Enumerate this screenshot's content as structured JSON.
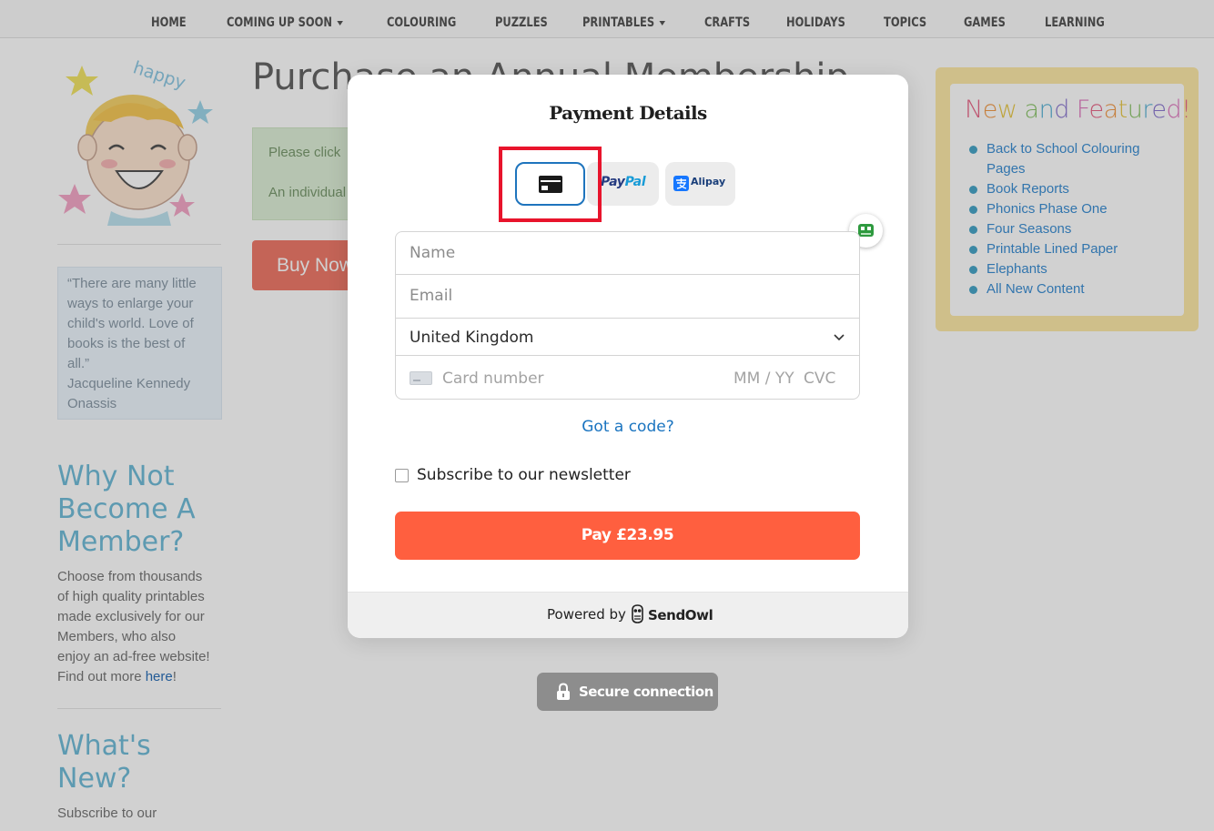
{
  "nav": {
    "items": [
      {
        "label": "HOME"
      },
      {
        "label": "COMING UP SOON",
        "has_dropdown": true
      },
      {
        "label": "COLOURING"
      },
      {
        "label": "PUZZLES"
      },
      {
        "label": "PRINTABLES",
        "has_dropdown": true
      },
      {
        "label": "CRAFTS"
      },
      {
        "label": "HOLIDAYS"
      },
      {
        "label": "TOPICS"
      },
      {
        "label": "GAMES"
      },
      {
        "label": "LEARNING"
      }
    ]
  },
  "sidebar": {
    "mascot_word": "happy",
    "quote": {
      "lines": [
        "“There are many little",
        "ways to enlarge your",
        "child's world. Love of",
        "books is the best of",
        "all.”",
        "Jacqueline Kennedy",
        "Onassis"
      ]
    },
    "member": {
      "heading_lines": [
        "Why Not",
        "Become A",
        "Member?"
      ],
      "text_lines": [
        "Choose from thousands",
        "of high quality printables",
        "made exclusively for our",
        "Members, who also",
        "enjoy an ad-free website!"
      ],
      "find_out_prefix": "Find out more ",
      "find_out_link": "here",
      "find_out_suffix": "!"
    },
    "whats_new": {
      "heading_lines": [
        "What's",
        "New?"
      ],
      "text": "Subscribe to our"
    }
  },
  "main": {
    "page_title": "Purchase an Annual Membership",
    "notice_line_1": "Please click",
    "notice_line_2": "An individual",
    "buy_now_label": "Buy Now"
  },
  "featured": {
    "title": "New and Featured!",
    "items": [
      {
        "label": "Back to School Colouring Pages"
      },
      {
        "label": "Book Reports"
      },
      {
        "label": "Phonics Phase One"
      },
      {
        "label": "Four Seasons"
      },
      {
        "label": "Printable Lined Paper"
      },
      {
        "label": "Elephants"
      },
      {
        "label": "All New Content"
      }
    ]
  },
  "modal": {
    "title": "Payment Details",
    "payment_methods": {
      "card": "card-icon",
      "paypal_pay": "Pay",
      "paypal_pal": "Pal",
      "alipay": "Alipay",
      "selected": "card"
    },
    "fields": {
      "name_placeholder": "Name",
      "email_placeholder": "Email",
      "country_value": "United Kingdom",
      "card_number_placeholder": "Card number",
      "expiry_placeholder": "MM / YY",
      "cvc_placeholder": "CVC"
    },
    "got_code": "Got a code?",
    "newsletter_label": "Subscribe to our newsletter",
    "pay_button": "Pay £23.95",
    "footer": {
      "powered_by": "Powered by",
      "brand": "SendOwl"
    }
  },
  "secure_connection": "Secure connection",
  "colors": {
    "pay_button": "#ff5f3f",
    "link": "#1a74c0",
    "selected_border": "#1e74bd",
    "highlight_box": "#e8142c"
  }
}
